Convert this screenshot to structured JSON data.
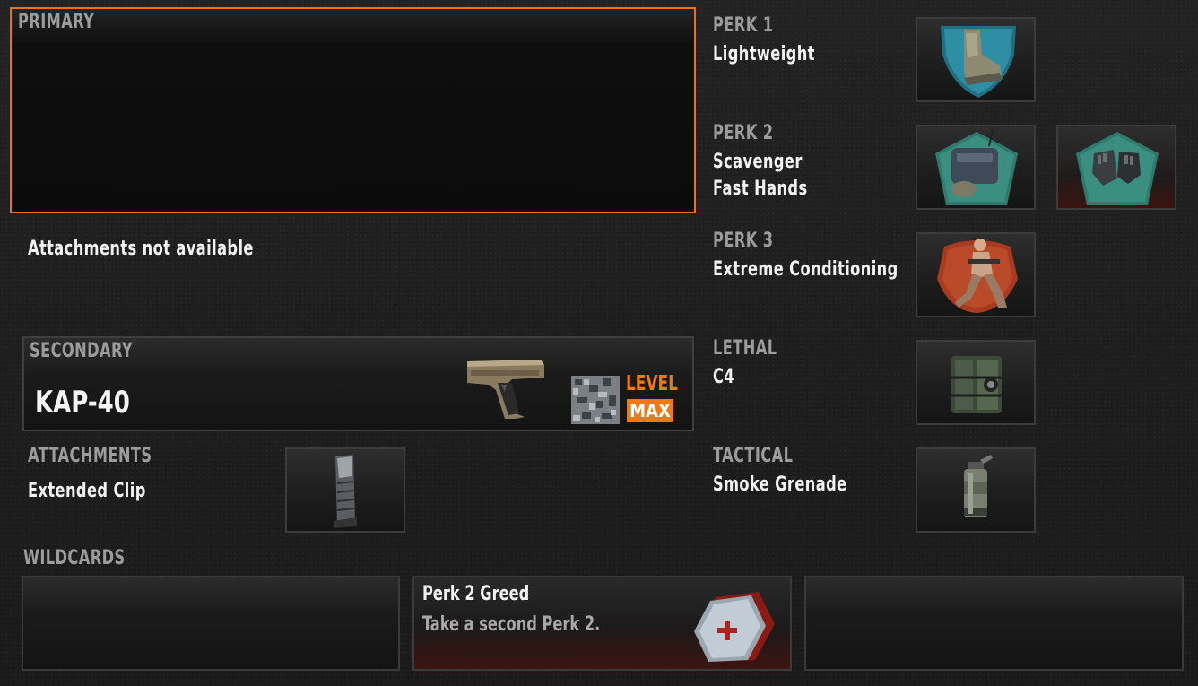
{
  "primary": {
    "header": "PRIMARY",
    "attachments_text": "Attachments not available"
  },
  "secondary": {
    "header": "SECONDARY",
    "weapon_name": "KAP-40",
    "weapon_icon": "pistol-icon",
    "camo_icon": "digital-camo-icon",
    "level_label": "LEVEL",
    "level_value": "MAX"
  },
  "attachments": {
    "header": "ATTACHMENTS",
    "item": "Extended Clip",
    "icon": "extended-clip-icon"
  },
  "perk1": {
    "header": "PERK 1",
    "items": [
      "Lightweight"
    ],
    "icons": [
      "boot-icon"
    ]
  },
  "perk2": {
    "header": "PERK 2",
    "items": [
      "Scavenger",
      "Fast Hands"
    ],
    "icons": [
      "backpack-icon",
      "gloves-icon"
    ]
  },
  "perk3": {
    "header": "PERK 3",
    "items": [
      "Extreme Conditioning"
    ],
    "icons": [
      "running-soldier-icon"
    ]
  },
  "lethal": {
    "header": "LETHAL",
    "items": [
      "C4"
    ],
    "icons": [
      "c4-icon"
    ]
  },
  "tactical": {
    "header": "TACTICAL",
    "items": [
      "Smoke Grenade"
    ],
    "icons": [
      "smoke-grenade-icon"
    ]
  },
  "wildcards": {
    "header": "WILDCARDS",
    "slots": [
      {
        "title": "",
        "description": ""
      },
      {
        "title": "Perk 2 Greed",
        "description": "Take a second Perk 2.",
        "icon": "perk-greed-icon"
      },
      {
        "title": "",
        "description": ""
      }
    ]
  },
  "colors": {
    "accent": "#e8731e",
    "header_text": "#9c9c9c",
    "value_text": "#f2f2f2",
    "level_badge": "#f07a10"
  }
}
